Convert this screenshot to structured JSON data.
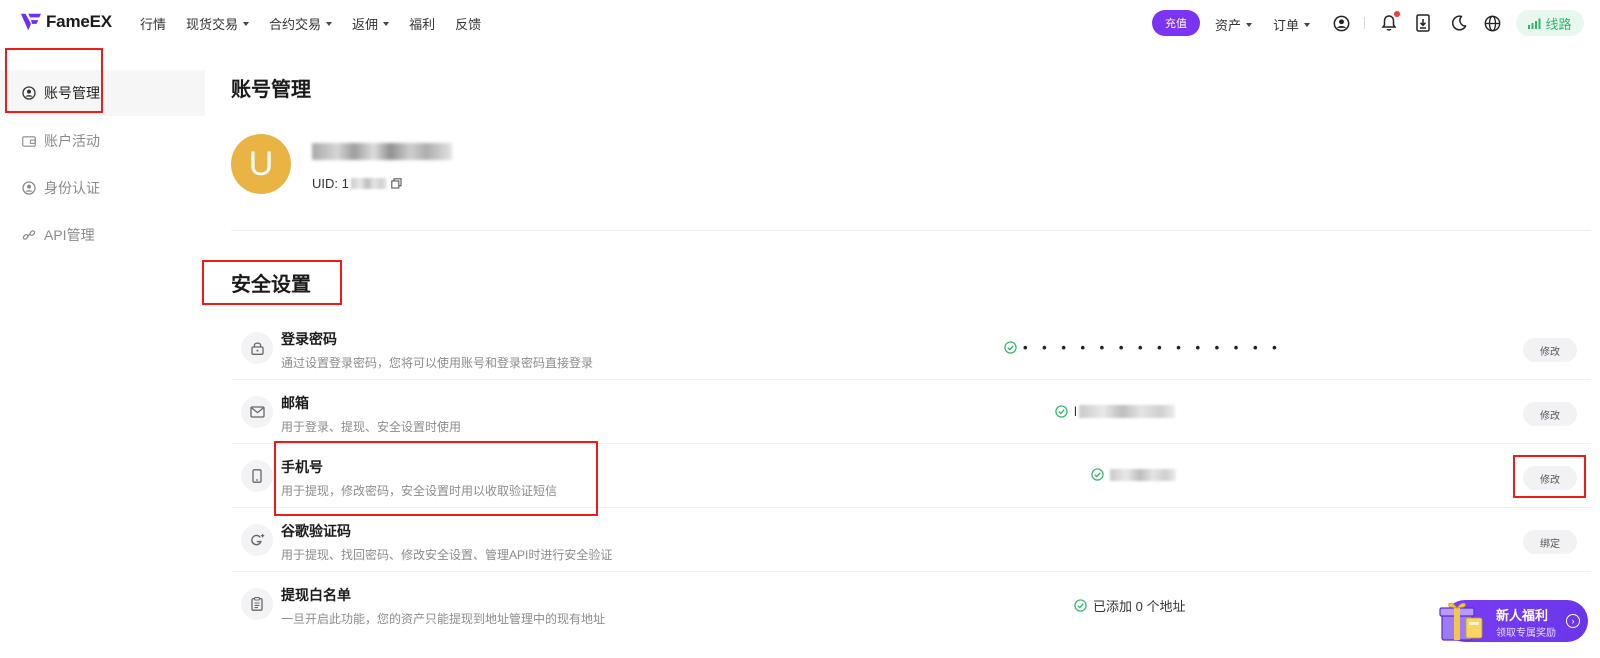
{
  "brand": {
    "name": "FameEX"
  },
  "nav": {
    "items": [
      {
        "label": "行情",
        "dropdown": false
      },
      {
        "label": "现货交易",
        "dropdown": true
      },
      {
        "label": "合约交易",
        "dropdown": true
      },
      {
        "label": "返佣",
        "dropdown": true
      },
      {
        "label": "福利",
        "dropdown": false
      },
      {
        "label": "反馈",
        "dropdown": false
      }
    ],
    "deposit_label": "充值",
    "assets_label": "资产",
    "orders_label": "订单",
    "route_label": "线路",
    "icons": [
      "user-icon",
      "bell-icon",
      "download-icon",
      "moon-icon",
      "globe-icon",
      "signal-icon"
    ]
  },
  "sidebar": {
    "items": [
      {
        "label": "账号管理",
        "icon": "user-circle-icon",
        "active": true
      },
      {
        "label": "账户活动",
        "icon": "wallet-icon",
        "active": false
      },
      {
        "label": "身份认证",
        "icon": "id-icon",
        "active": false
      },
      {
        "label": "API管理",
        "icon": "link-icon",
        "active": false
      }
    ]
  },
  "account": {
    "title": "账号管理",
    "avatar_letter": "U",
    "uid_label": "UID: 1"
  },
  "security": {
    "title": "安全设置",
    "rows": [
      {
        "title": "登录密码",
        "desc": "通过设置登录密码，您将可以使用账号和登录密码直接登录",
        "status": "• • • • • • • • • • • • • •",
        "button": "修改",
        "icon": "lock-icon"
      },
      {
        "title": "邮箱",
        "desc": "用于登录、提现、安全设置时使用",
        "status": "l",
        "button": "修改",
        "icon": "mail-icon"
      },
      {
        "title": "手机号",
        "desc": "用于提现，修改密码，安全设置时用以收取验证短信",
        "status": "",
        "button": "修改",
        "icon": "phone-icon"
      },
      {
        "title": "谷歌验证码",
        "desc": "用于提现、找回密码、修改安全设置、管理API时进行安全验证",
        "status": "",
        "button": "绑定",
        "icon": "google-icon"
      },
      {
        "title": "提现白名单",
        "desc": "一旦开启此功能，您的资产只能提现到地址管理中的现有地址",
        "status": "已添加 0 个地址",
        "button": "",
        "icon": "clipboard-icon"
      }
    ]
  },
  "promo": {
    "title": "新人福利",
    "subtitle": "领取专属奖励"
  },
  "colors": {
    "accent": "#7b34f1",
    "avatar": "#e9b443",
    "success": "#2fb56a",
    "highlight_box": "#f01a1a"
  }
}
